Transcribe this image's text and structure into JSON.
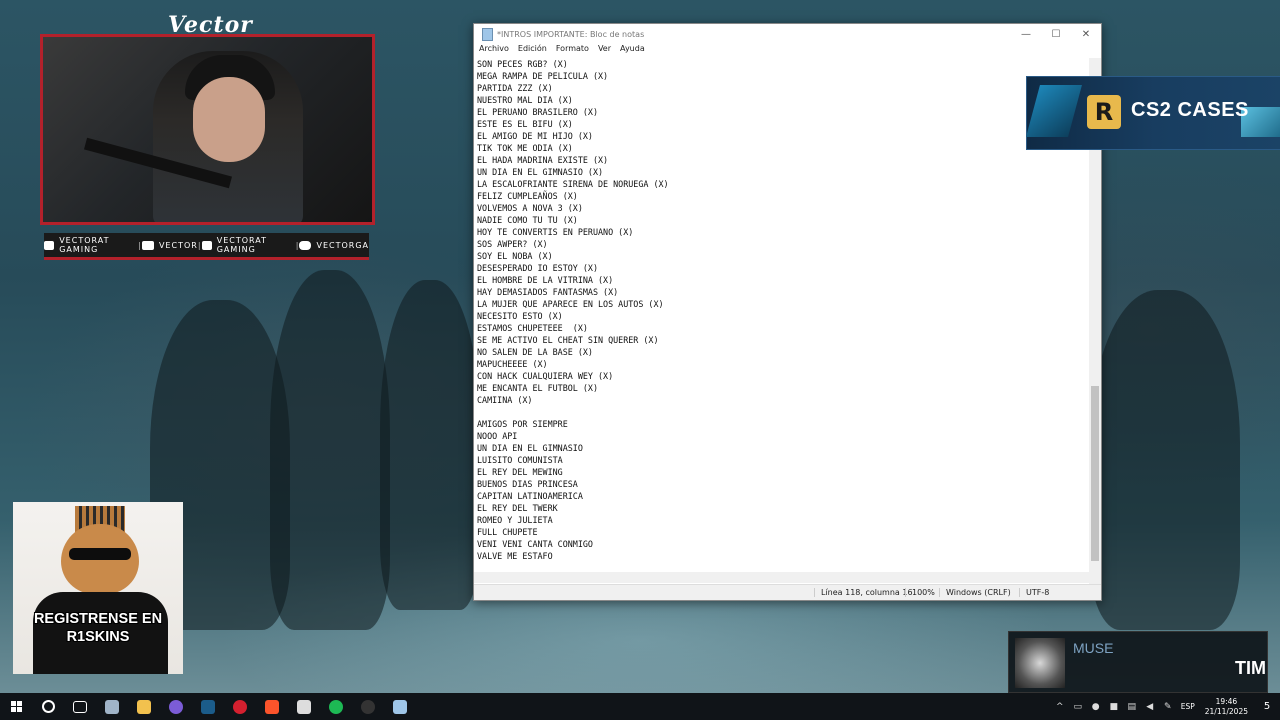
{
  "webcam": {
    "streamer_name": "Vector",
    "socials": [
      {
        "icon": "youtube-icon",
        "label": "VECTORAT GAMING"
      },
      {
        "icon": "twitch-icon",
        "label": "VECTOR"
      },
      {
        "icon": "twitter-icon",
        "label": "VECTORAT GAMING"
      },
      {
        "icon": "instagram-icon",
        "label": "VECTORGA"
      }
    ]
  },
  "notepad": {
    "title": "*INTROS IMPORTANTE: Bloc de notas",
    "controls": {
      "minimize": "—",
      "maximize": "☐",
      "close": "✕"
    },
    "menu": [
      "Archivo",
      "Edición",
      "Formato",
      "Ver",
      "Ayuda"
    ],
    "lines": [
      "SON PECES RGB? (X)",
      "MEGA RAMPA DE PELICULA (X)",
      "PARTIDA ZZZ (X)",
      "NUESTRO MAL DIA (X)",
      "EL PERUANO BRASILERO (X)",
      "ESTE ES EL BIFU (X)",
      "EL AMIGO DE MI HIJO (X)",
      "TIK TOK ME ODIA (X)",
      "EL HADA MADRINA EXISTE (X)",
      "UN DIA EN EL GIMNASIO (X)",
      "LA ESCALOFRIANTE SIRENA DE NORUEGA (X)",
      "FELIZ CUMPLEAÑOS (X)",
      "VOLVEMOS A NOVA 3 (X)",
      "NADIE COMO TU TU (X)",
      "HOY TE CONVERTIS EN PERUANO (X)",
      "SOS AWPER? (X)",
      "SOY EL NOBA (X)",
      "DESESPERADO IO ESTOY (X)",
      "EL HOMBRE DE LA VITRINA (X)",
      "HAY DEMASIADOS FANTASMAS (X)",
      "LA MUJER QUE APARECE EN LOS AUTOS (X)",
      "NECESITO ESTO (X)",
      "ESTAMOS CHUPETEEE  (X)",
      "SE ME ACTIVO EL CHEAT SIN QUERER (X)",
      "NO SALEN DE LA BASE (X)",
      "MAPUCHEEEE (X)",
      "CON HACK CUALQUIERA WEY (X)",
      "ME ENCANTA EL FUTBOL (X)",
      "CAMIINA (X)",
      "",
      "AMIGOS POR SIEMPRE",
      "NOOO API",
      "UN DIA EN EL GIMNASIO",
      "LUISITO COMUNISTA",
      "EL REY DEL MEWING",
      "BUENOS DIAS PRINCESA",
      "CAPITAN LATINOAMERICA",
      "EL REY DEL TWERK",
      "ROMEO Y JULIETA",
      "FULL CHUPETE",
      "VENI VENI CANTA CONMIGO",
      "VALVE ME ESTAFO"
    ],
    "status": {
      "position": "Línea 118, columna 16",
      "zoom": "100%",
      "line_ending": "Windows (CRLF)",
      "encoding": "UTF-8"
    }
  },
  "cs2_banner": {
    "logo": "R",
    "text": "CS2 CASES"
  },
  "cat_panel": {
    "text": "REGISTRENSE EN R1SKINS"
  },
  "music": {
    "artist": "MUSE",
    "track": "TIM"
  },
  "taskbar": {
    "apps": [
      {
        "icon": "search-icon",
        "color": "#ffffff"
      },
      {
        "icon": "task-view-icon",
        "color": "#ffffff"
      },
      {
        "icon": "file-explorer-app-icon",
        "color": "#a0b4c8"
      },
      {
        "icon": "folder-icon",
        "color": "#f2c14e"
      },
      {
        "icon": "discord-icon",
        "color": "#7b5cd6"
      },
      {
        "icon": "steam-icon",
        "color": "#1b5c8a"
      },
      {
        "icon": "opera-icon",
        "color": "#d4202f"
      },
      {
        "icon": "brave-icon",
        "color": "#fb542b"
      },
      {
        "icon": "game-launcher-icon",
        "color": "#dddddd"
      },
      {
        "icon": "spotify-icon",
        "color": "#1db954"
      },
      {
        "icon": "obs-icon",
        "color": "#333333"
      },
      {
        "icon": "notepad-icon",
        "color": "#9fc6e8"
      }
    ],
    "language": "ESP",
    "time": "19:46",
    "date": "21/11/2025",
    "notifications": "5"
  }
}
